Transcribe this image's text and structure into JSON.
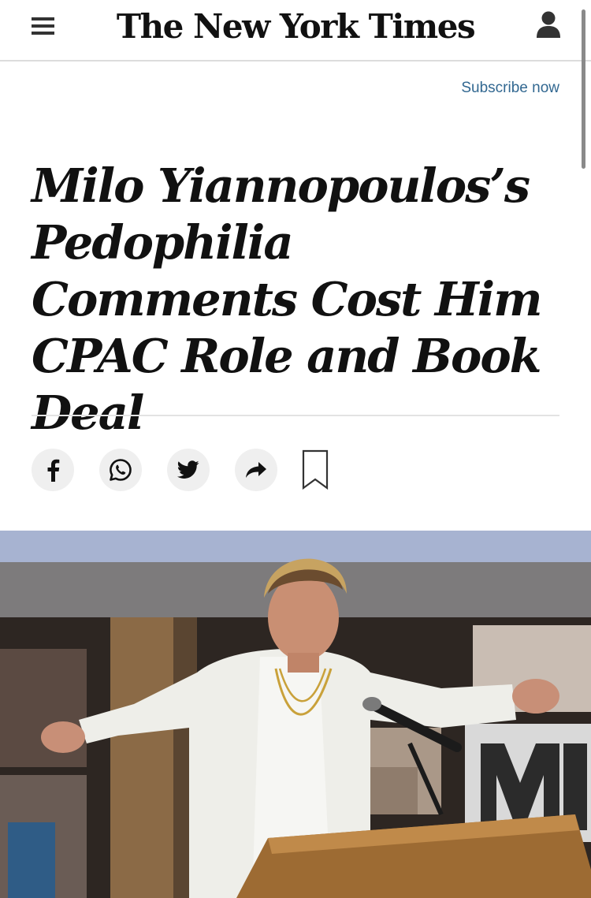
{
  "header": {
    "menu_icon": "hamburger-menu-icon",
    "logo": "The New York Times",
    "account_icon": "user-account-icon"
  },
  "subscribe_label": "Subscribe now",
  "article": {
    "headline": "Milo Yiannopoulos’s Pedophilia Comments Cost Him CPAC Role and Book Deal"
  },
  "share_bar": {
    "buttons": [
      {
        "icon": "facebook-icon"
      },
      {
        "icon": "whatsapp-icon"
      },
      {
        "icon": "twitter-icon"
      },
      {
        "icon": "share-arrow-icon"
      },
      {
        "icon": "bookmark-icon"
      }
    ]
  },
  "colors": {
    "link": "#326891",
    "text": "#111111",
    "button_bg": "#efefef"
  }
}
